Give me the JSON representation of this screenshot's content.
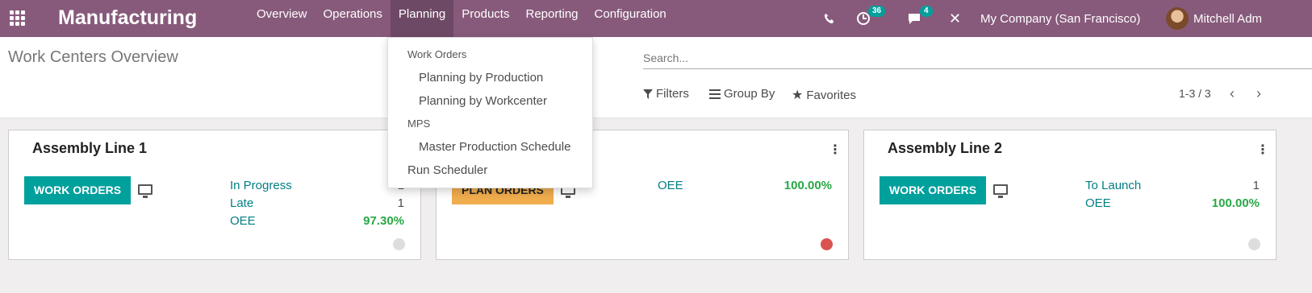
{
  "app": {
    "title": "Manufacturing"
  },
  "menu": [
    "Overview",
    "Operations",
    "Planning",
    "Products",
    "Reporting",
    "Configuration"
  ],
  "systray": {
    "activity_count": "36",
    "message_count": "4",
    "company": "My Company (San Francisco)",
    "user": "Mitchell Adm"
  },
  "control_panel": {
    "title": "Work Centers Overview",
    "search_placeholder": "Search...",
    "filters_label": "Filters",
    "group_by_label": "Group By",
    "favorites_label": "Favorites",
    "pager": "1-3 / 3"
  },
  "planning_dropdown": {
    "section_work_orders": "Work Orders",
    "planning_by_production": "Planning by Production",
    "planning_by_workcenter": "Planning by Workcenter",
    "section_mps": "MPS",
    "master_production_schedule": "Master Production Schedule",
    "run_scheduler": "Run Scheduler"
  },
  "cards": [
    {
      "name": "Assembly Line 1",
      "button": "WORK ORDERS",
      "stats": [
        {
          "label": "In Progress",
          "value": "1"
        },
        {
          "label": "Late",
          "value": "1"
        },
        {
          "label": "OEE",
          "value": "97.30%"
        }
      ],
      "status_color": "#dddddd"
    },
    {
      "name": "",
      "button": "PLAN ORDERS",
      "stats": [
        {
          "label": "OEE",
          "value": "100.00%"
        }
      ],
      "status_color": "#d9534f"
    },
    {
      "name": "Assembly Line 2",
      "button": "WORK ORDERS",
      "stats": [
        {
          "label": "To Launch",
          "value": "1"
        },
        {
          "label": "OEE",
          "value": "100.00%"
        }
      ],
      "status_color": "#dddddd"
    }
  ],
  "icons": {
    "apps": "apps-grid-icon",
    "phone": "phone-icon",
    "activity": "clock-icon",
    "messages": "chat-icon",
    "debug": "close-icon",
    "monitor": "monitor-icon",
    "kebab": "vertical-ellipsis-icon"
  },
  "colors": {
    "brand": "#875a7b",
    "primary": "#00a09d",
    "warning": "#f0ad4e",
    "danger": "#d9534f"
  }
}
